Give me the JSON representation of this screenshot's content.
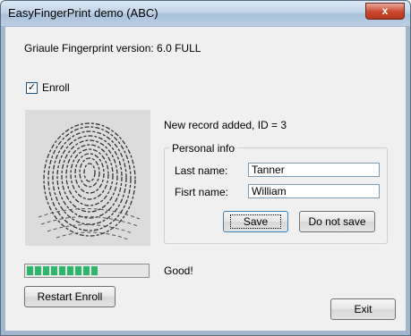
{
  "window": {
    "title": "EasyFingerPrint demo (ABC)",
    "close_glyph": "x"
  },
  "header": {
    "version_text": "Griaule Fingerprint version: 6.0 FULL"
  },
  "enroll": {
    "checked": true,
    "check_glyph": "✓",
    "label": "Enroll"
  },
  "status": {
    "record_message": "New record added, ID = 3",
    "quality_text": "Good!"
  },
  "personal_info": {
    "title": "Personal info",
    "last_name_label": "Last name:",
    "last_name_value": "Tanner",
    "first_name_label": "Fisrt name:",
    "first_name_value": "William"
  },
  "buttons": {
    "save": "Save",
    "do_not_save": "Do not save",
    "restart": "Restart Enroll",
    "exit": "Exit"
  },
  "progress": {
    "segments_filled": 9,
    "color": "#2fb56c"
  },
  "colors": {
    "dialog_bg": "#f0f0f0",
    "titlebar": "#c3d5e8",
    "close_button": "#c9472d"
  }
}
